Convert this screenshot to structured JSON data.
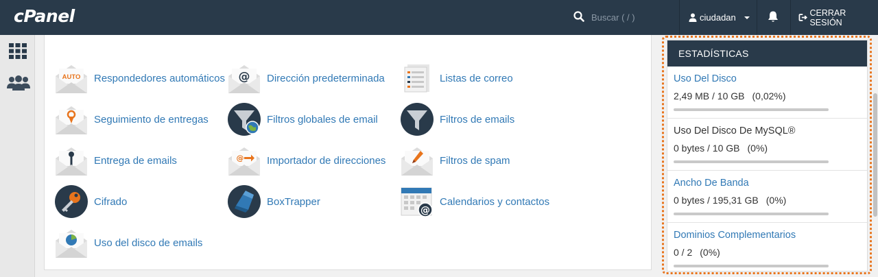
{
  "header": {
    "logo": "cPanel",
    "search_placeholder": "Buscar ( / )",
    "user": "ciudadan",
    "logout": "CERRAR SESIÓN"
  },
  "tools": [
    {
      "label": "Respondedores automáticos",
      "icon": "autoresponder-icon",
      "icon_text": "AUTO"
    },
    {
      "label": "Dirección predeterminada",
      "icon": "default-address-icon"
    },
    {
      "label": "Listas de correo",
      "icon": "mailing-lists-icon"
    },
    {
      "label": "Seguimiento de entregas",
      "icon": "track-delivery-icon"
    },
    {
      "label": "Filtros globales de email",
      "icon": "global-filters-icon"
    },
    {
      "label": "Filtros de emails",
      "icon": "email-filters-icon"
    },
    {
      "label": "Entrega de emails",
      "icon": "email-routing-icon"
    },
    {
      "label": "Importador de direcciones",
      "icon": "address-importer-icon"
    },
    {
      "label": "Filtros de spam",
      "icon": "spam-filters-icon"
    },
    {
      "label": "Cifrado",
      "icon": "encryption-icon"
    },
    {
      "label": "BoxTrapper",
      "icon": "boxtrapper-icon"
    },
    {
      "label": "Calendarios y contactos",
      "icon": "calendars-contacts-icon"
    },
    {
      "label": "Uso del disco de emails",
      "icon": "email-disk-usage-icon"
    }
  ],
  "stats": {
    "title": "ESTADÍSTICAS",
    "items": [
      {
        "title": "Uso Del Disco",
        "value": "2,49 MB / 10 GB",
        "percent": "(0,02%)",
        "fraction": 0.0002,
        "link": true
      },
      {
        "title": "Uso Del Disco De MySQL®",
        "value": "0 bytes / 10 GB",
        "percent": "(0%)",
        "fraction": 0,
        "link": false
      },
      {
        "title": "Ancho De Banda",
        "value": "0 bytes / 195,31 GB",
        "percent": "(0%)",
        "fraction": 0,
        "link": true
      },
      {
        "title": "Dominios Complementarios",
        "value": "0 / 2",
        "percent": "(0%)",
        "fraction": 0,
        "link": true
      }
    ]
  },
  "colors": {
    "topbar": "#293a4a",
    "link": "#3179b5",
    "highlight_outline": "#e8741c"
  }
}
